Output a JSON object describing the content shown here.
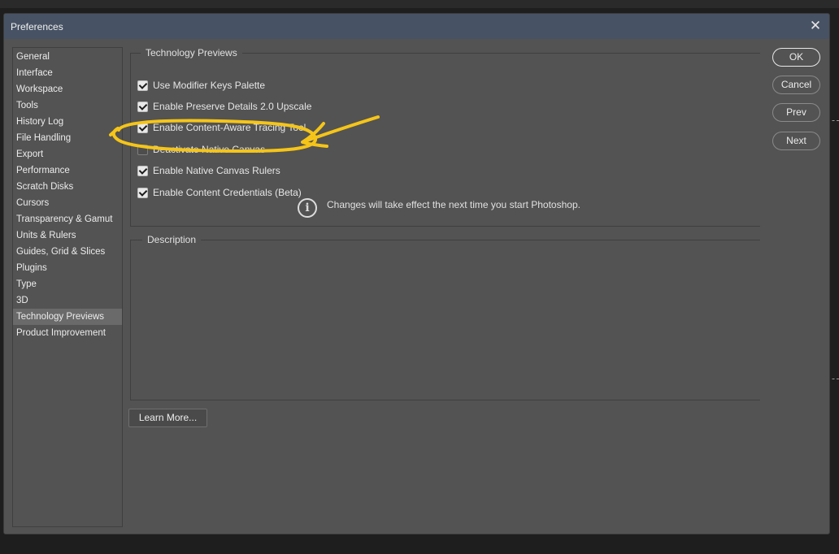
{
  "window": {
    "title": "Preferences"
  },
  "sidebar": {
    "items": [
      {
        "label": "General",
        "active": false
      },
      {
        "label": "Interface",
        "active": false
      },
      {
        "label": "Workspace",
        "active": false
      },
      {
        "label": "Tools",
        "active": false
      },
      {
        "label": "History Log",
        "active": false
      },
      {
        "label": "File Handling",
        "active": false
      },
      {
        "label": "Export",
        "active": false
      },
      {
        "label": "Performance",
        "active": false
      },
      {
        "label": "Scratch Disks",
        "active": false
      },
      {
        "label": "Cursors",
        "active": false
      },
      {
        "label": "Transparency & Gamut",
        "active": false
      },
      {
        "label": "Units & Rulers",
        "active": false
      },
      {
        "label": "Guides, Grid & Slices",
        "active": false
      },
      {
        "label": "Plugins",
        "active": false
      },
      {
        "label": "Type",
        "active": false
      },
      {
        "label": "3D",
        "active": false
      },
      {
        "label": "Technology Previews",
        "active": true
      },
      {
        "label": "Product Improvement",
        "active": false
      }
    ]
  },
  "tech_previews": {
    "legend": "Technology Previews",
    "options": [
      {
        "label": "Use Modifier Keys Palette",
        "checked": true
      },
      {
        "label": "Enable Preserve Details 2.0 Upscale",
        "checked": true
      },
      {
        "label": "Enable Content-Aware Tracing Tool",
        "checked": true
      },
      {
        "label": "Deactivate Native Canvas",
        "checked": false
      },
      {
        "label": "Enable Native Canvas Rulers",
        "checked": true
      },
      {
        "label": "Enable Content Credentials (Beta)",
        "checked": true
      }
    ],
    "notice": "Changes will take effect the next time you start Photoshop.",
    "notice_icon": "info-icon"
  },
  "description": {
    "legend": "Description"
  },
  "buttons": {
    "ok": "OK",
    "cancel": "Cancel",
    "prev": "Prev",
    "next": "Next",
    "learn_more": "Learn More..."
  },
  "annotation": {
    "color": "#f5c518"
  }
}
